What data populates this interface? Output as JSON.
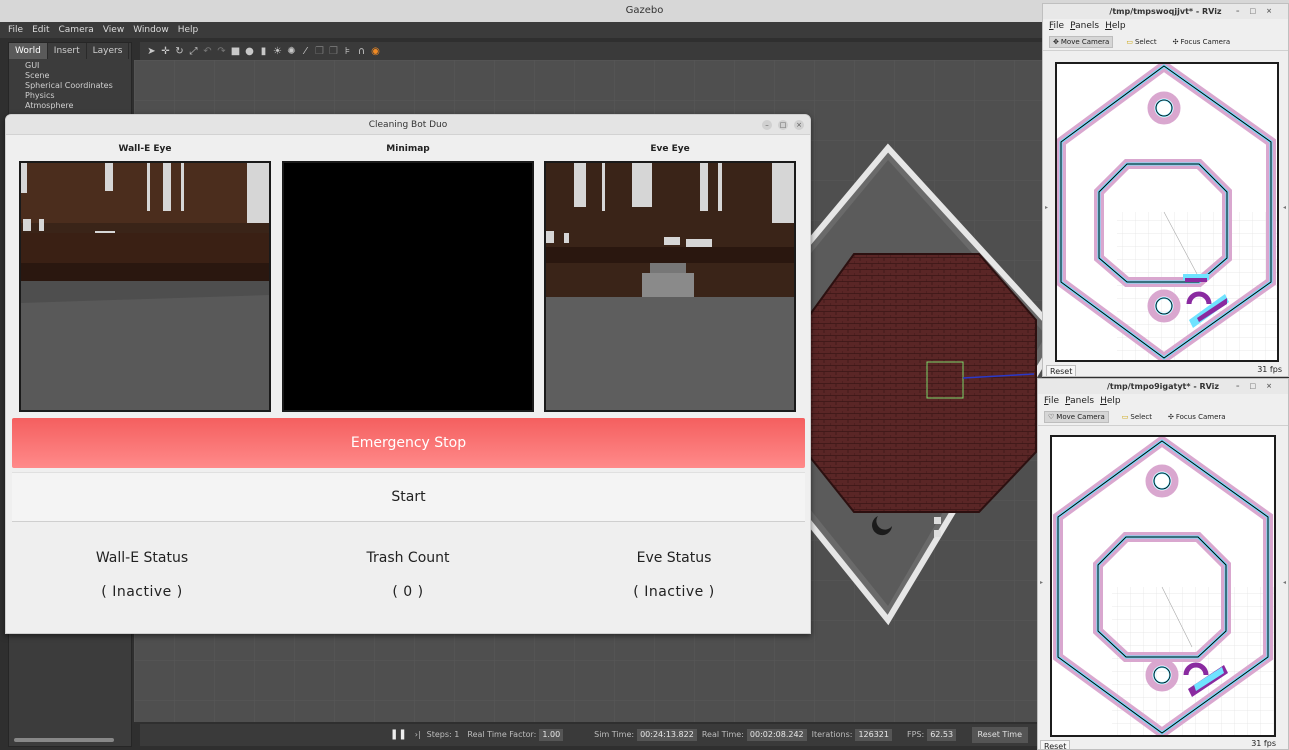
{
  "gazebo": {
    "title": "Gazebo",
    "menu": [
      "File",
      "Edit",
      "Camera",
      "View",
      "Window",
      "Help"
    ],
    "tabs": [
      "World",
      "Insert",
      "Layers"
    ],
    "tree": [
      "GUI",
      "Scene",
      "Spherical Coordinates",
      "Physics",
      "Atmosphere"
    ],
    "bottom": {
      "steps_label": "Steps: 1",
      "rtf_label": "Real Time Factor:",
      "rtf_value": "1.00",
      "sim_label": "Sim Time:",
      "sim_value": "00:24:13.822",
      "real_label": "Real Time:",
      "real_value": "00:02:08.242",
      "iter_label": "Iterations:",
      "iter_value": "126321",
      "fps_label": "FPS:",
      "fps_value": "62.53",
      "reset_time": "Reset Time"
    }
  },
  "cbd": {
    "title": "Cleaning Bot Duo",
    "cam_left": "Wall-E Eye",
    "cam_center": "Minimap",
    "cam_right": "Eve Eye",
    "emergency_stop": "Emergency Stop",
    "start": "Start",
    "wall_e_status_label": "Wall-E Status",
    "trash_count_label": "Trash Count",
    "eve_status_label": "Eve Status",
    "wall_e_status": "( Inactive )",
    "trash_count": "( 0 )",
    "eve_status": "( Inactive )"
  },
  "rviz_top": {
    "title": "/tmp/tmpswoqjjvt* - RViz",
    "menu": [
      "File",
      "Panels",
      "Help"
    ],
    "tools": [
      "Move Camera",
      "Select",
      "Focus Camera"
    ],
    "reset": "Reset",
    "fps": "31 fps"
  },
  "rviz_bottom": {
    "title": "/tmp/tmpo9igatyt* - RViz",
    "menu": [
      "File",
      "Panels",
      "Help"
    ],
    "tools": [
      "Move Camera",
      "Select",
      "Focus Camera"
    ],
    "reset": "Reset",
    "fps": "31 fps"
  },
  "colors": {
    "estop": "#f45f5f",
    "map_pink": "#d9a7cf",
    "map_cyan": "#6fe3ff",
    "map_purple": "#8a2aa0"
  }
}
